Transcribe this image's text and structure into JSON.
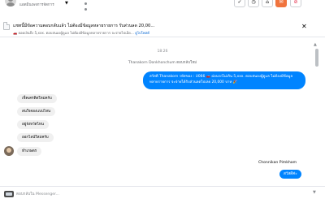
{
  "header": {
    "account_name": "แอดมินเพจการจัดการ ",
    "caret": "▼",
    "btn_check": "✓",
    "btn_clock": "◷",
    "btn_folder": "⌂",
    "btn_mail": "✉",
    "btn_block": "⊘",
    "colors": {
      "orange": "#f0743e",
      "red": "#e41e3f"
    }
  },
  "banner": {
    "title": "แชทนี้มีข้อความตอบกลับแล้ว ไม่ต้องมีข้อมูลหลายรายการ รับส่วนลด 20,00...",
    "subtitle_prefix": "🚗 ยอดเงินถึง 5,xxx. ตอบสนองผู้ดูแล ไม่ต้องมีข้อมูลหลายรายการ จะจ่ายไปเอ็ด... ",
    "subtitle_link": "ดูไปโพสต์",
    "close": "✕"
  },
  "chat": {
    "timestamp": "18:26",
    "assignment": "Thanakorn Donkhonchum ตอบกลับใหม่",
    "outgoing_message": "สวัสดี Thanakorn รหัสของ : U066 🚗 ผ่อนรถไม่เกิน 5,xxx. ตอบสนองผู้ดูแล ไม่ต้องมีข้อมูลหลายรายการ จะจ่ายได้รับส่วนลดไปเลย 20,000 บาท 🎉",
    "incoming": [
      "เช็คเครดิตใหม่ครับ",
      "สนใจจองแบบไหน",
      "อยู่จังหวัดไหน",
      "ออกไลน์ใหม่ครับ",
      "ทำเกษตร"
    ],
    "agent_name": "Chonnikan Pimkham",
    "agent_reply": "สวัสดีค่ะ",
    "scroll_up": "▲"
  },
  "composer": {
    "placeholder": "ตอบกลับใน Messenger...",
    "scroll_down": "▼"
  }
}
